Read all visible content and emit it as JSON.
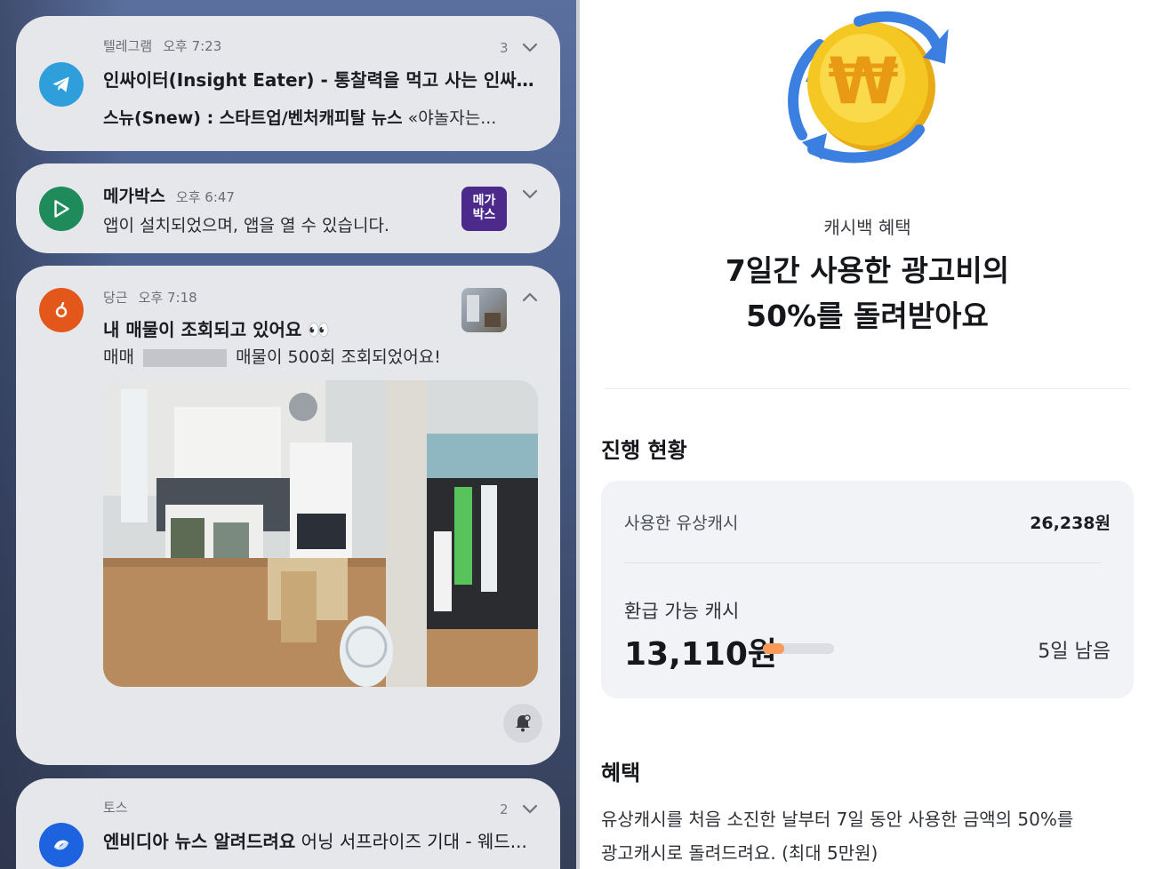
{
  "notifications": [
    {
      "app": "텔레그램",
      "time": "오후 7:23",
      "count": "3",
      "title": "인싸이터(Insight Eater) - 통찰력을 먹고 사는 인싸들...",
      "body_bold": "스뉴(Snew) : 스타트업/벤처캐피탈 뉴스",
      "body_rest": " «야놀자는..."
    },
    {
      "app": "메가박스",
      "time": "오후 6:47",
      "body": "앱이 설치되었으며, 앱을 열 수 있습니다.",
      "thumb_label": "메가\n박스"
    },
    {
      "app": "당근",
      "time": "오후 7:18",
      "title": "내 매물이 조회되고 있어요 👀",
      "body_prefix": "매매",
      "body_suffix": "매물이 500회 조회되었어요!"
    },
    {
      "app": "토스",
      "time": "",
      "count": "2",
      "title_bold": "엔비디아 뉴스 알려드려요",
      "title_rest": " 어닝 서프라이즈 기대 - 웨드..."
    }
  ],
  "cashback": {
    "label": "캐시백 혜택",
    "headline_line1": "7일간 사용한 광고비의",
    "headline_line2": "50%를 돌려받아요",
    "progress_section_title": "진행 현황",
    "used_label": "사용한 유상캐시",
    "used_value": "26,238원",
    "refund_label": "환급 가능 캐시",
    "refund_value": "13,110원",
    "progress_fraction": 0.3,
    "days_left": "5일 남음",
    "benefit_title": "혜택",
    "benefit_line1": "유상캐시를 처음 소진한 날부터 7일 동안 사용한 금액의 50%를",
    "benefit_line2": "광고캐시로 돌려드려요. (최대 5만원)"
  },
  "colors": {
    "telegram": "#2e9fdb",
    "megabox_install": "#1f8a5a",
    "megabox_brand": "#4b2a8c",
    "daangn": "#e4571b",
    "toss": "#1d63e0",
    "progress_fill": "#f79a5a",
    "coin": "#f5c722",
    "arrows": "#3b7fe0"
  }
}
